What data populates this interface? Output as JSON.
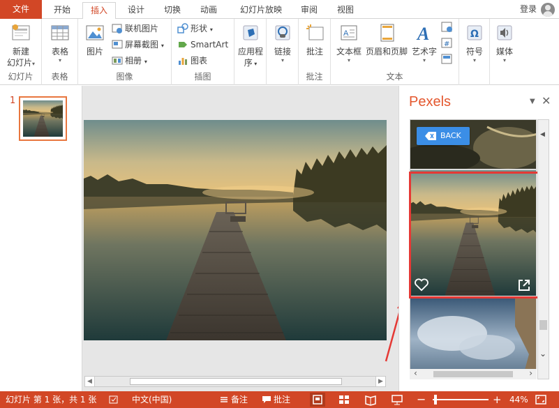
{
  "tabs": {
    "file": "文件",
    "items": [
      "开始",
      "插入",
      "设计",
      "切换",
      "动画",
      "幻灯片放映",
      "审阅",
      "视图"
    ],
    "active": "插入",
    "login": "登录"
  },
  "ribbon": {
    "groups": {
      "slides": "幻灯片",
      "tables": "表格",
      "images": "图像",
      "illustrations": "插图",
      "comments": "批注",
      "text": "文本"
    },
    "buttons": {
      "new_slide": "新建\n幻灯片",
      "new_slide_l1": "新建",
      "new_slide_l2": "幻灯片",
      "table": "表格",
      "picture": "图片",
      "online_pictures": "联机图片",
      "screenshot": "屏幕截图",
      "album": "相册",
      "shapes": "形状",
      "smartart": "SmartArt",
      "chart": "图表",
      "apps_l1": "应用程",
      "apps_l2": "序",
      "link": "链接",
      "comment": "批注",
      "textbox": "文本框",
      "header_footer": "页眉和页脚",
      "wordart": "艺术字",
      "symbol": "符号",
      "media": "媒体"
    }
  },
  "thumbnails": {
    "slide_number": "1"
  },
  "pexels": {
    "title": "Pexels",
    "back": "BACK"
  },
  "status": {
    "slide_info": "幻灯片 第 1 张，共 1 张",
    "language": "中文(中国)",
    "notes": "备注",
    "comments": "批注",
    "zoom": "44%"
  },
  "colors": {
    "accent": "#d24726",
    "pexels_title": "#e4572e",
    "highlight": "#e53935",
    "back_button": "#3b8ee6"
  }
}
